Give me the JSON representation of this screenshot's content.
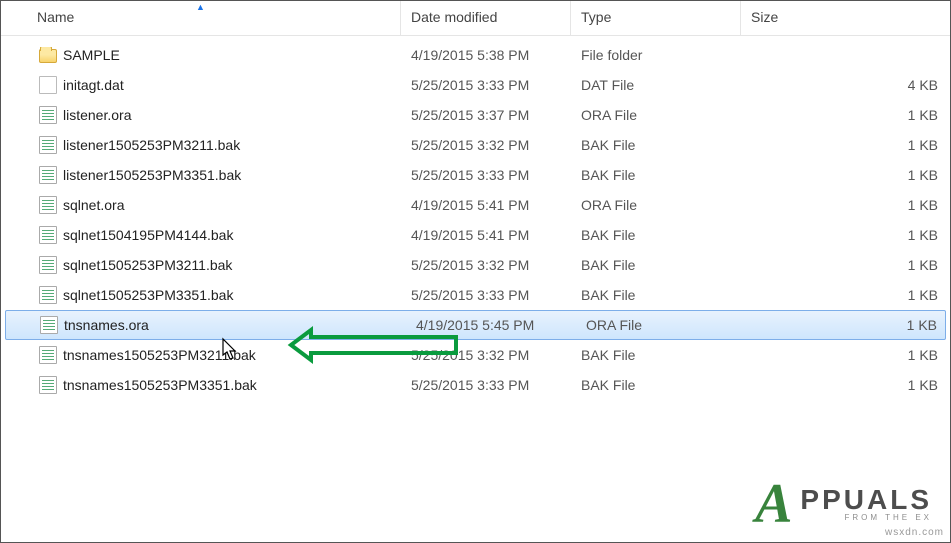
{
  "columns": {
    "name": "Name",
    "date": "Date modified",
    "type": "Type",
    "size": "Size"
  },
  "files": [
    {
      "icon": "folder",
      "name": "SAMPLE",
      "date": "4/19/2015 5:38 PM",
      "type": "File folder",
      "size": "",
      "selected": false
    },
    {
      "icon": "dat",
      "name": "initagt.dat",
      "date": "5/25/2015 3:33 PM",
      "type": "DAT File",
      "size": "4 KB",
      "selected": false
    },
    {
      "icon": "file",
      "name": "listener.ora",
      "date": "5/25/2015 3:37 PM",
      "type": "ORA File",
      "size": "1 KB",
      "selected": false
    },
    {
      "icon": "file",
      "name": "listener1505253PM3211.bak",
      "date": "5/25/2015 3:32 PM",
      "type": "BAK File",
      "size": "1 KB",
      "selected": false
    },
    {
      "icon": "file",
      "name": "listener1505253PM3351.bak",
      "date": "5/25/2015 3:33 PM",
      "type": "BAK File",
      "size": "1 KB",
      "selected": false
    },
    {
      "icon": "file",
      "name": "sqlnet.ora",
      "date": "4/19/2015 5:41 PM",
      "type": "ORA File",
      "size": "1 KB",
      "selected": false
    },
    {
      "icon": "file",
      "name": "sqlnet1504195PM4144.bak",
      "date": "4/19/2015 5:41 PM",
      "type": "BAK File",
      "size": "1 KB",
      "selected": false
    },
    {
      "icon": "file",
      "name": "sqlnet1505253PM3211.bak",
      "date": "5/25/2015 3:32 PM",
      "type": "BAK File",
      "size": "1 KB",
      "selected": false
    },
    {
      "icon": "file",
      "name": "sqlnet1505253PM3351.bak",
      "date": "5/25/2015 3:33 PM",
      "type": "BAK File",
      "size": "1 KB",
      "selected": false
    },
    {
      "icon": "file",
      "name": "tnsnames.ora",
      "date": "4/19/2015 5:45 PM",
      "type": "ORA File",
      "size": "1 KB",
      "selected": true
    },
    {
      "icon": "file",
      "name": "tnsnames1505253PM3211.bak",
      "date": "5/25/2015 3:32 PM",
      "type": "BAK File",
      "size": "1 KB",
      "selected": false
    },
    {
      "icon": "file",
      "name": "tnsnames1505253PM3351.bak",
      "date": "5/25/2015 3:33 PM",
      "type": "BAK File",
      "size": "1 KB",
      "selected": false
    }
  ],
  "watermark": {
    "logo_a": "A",
    "main": "PPUALS",
    "sub": "FROM THE EX"
  },
  "footer_text": "wsxdn.com"
}
